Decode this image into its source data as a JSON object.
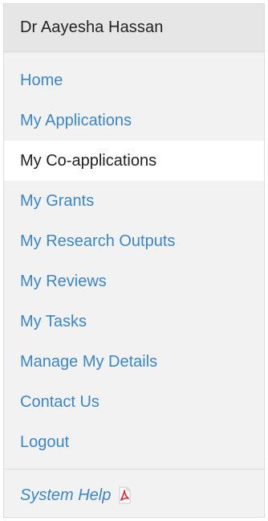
{
  "user": {
    "name": "Dr Aayesha Hassan"
  },
  "nav": {
    "items": [
      {
        "label": "Home",
        "active": false
      },
      {
        "label": "My Applications",
        "active": false
      },
      {
        "label": "My Co-applications",
        "active": true
      },
      {
        "label": "My Grants",
        "active": false
      },
      {
        "label": "My Research Outputs",
        "active": false
      },
      {
        "label": "My Reviews",
        "active": false
      },
      {
        "label": "My Tasks",
        "active": false
      },
      {
        "label": "Manage My Details",
        "active": false
      },
      {
        "label": "Contact Us",
        "active": false
      },
      {
        "label": "Logout",
        "active": false
      }
    ]
  },
  "help": {
    "label": "System Help",
    "icon": "pdf-icon"
  },
  "colors": {
    "link": "#3a86c8",
    "active_text": "#222222",
    "panel_bg": "#f2f2f2",
    "header_bg": "#e6e6e6",
    "pdf_red": "#d9262c"
  }
}
